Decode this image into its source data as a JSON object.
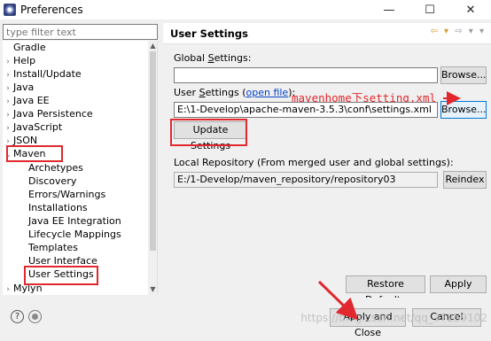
{
  "window": {
    "title": "Preferences",
    "minimize": "—",
    "maximize": "☐",
    "close": "✕"
  },
  "filter": {
    "placeholder": "type filter text"
  },
  "tree": {
    "items": [
      {
        "label": "Gradle",
        "twisty": ""
      },
      {
        "label": "Help",
        "twisty": "›"
      },
      {
        "label": "Install/Update",
        "twisty": "›"
      },
      {
        "label": "Java",
        "twisty": "›"
      },
      {
        "label": "Java EE",
        "twisty": "›"
      },
      {
        "label": "Java Persistence",
        "twisty": "›"
      },
      {
        "label": "JavaScript",
        "twisty": "›"
      },
      {
        "label": "JSON",
        "twisty": "›"
      },
      {
        "label": "Maven",
        "twisty": "⌄"
      },
      {
        "label": "Archetypes",
        "twisty": ""
      },
      {
        "label": "Discovery",
        "twisty": ""
      },
      {
        "label": "Errors/Warnings",
        "twisty": ""
      },
      {
        "label": "Installations",
        "twisty": ""
      },
      {
        "label": "Java EE Integration",
        "twisty": ""
      },
      {
        "label": "Lifecycle Mappings",
        "twisty": ""
      },
      {
        "label": "Templates",
        "twisty": ""
      },
      {
        "label": "User Interface",
        "twisty": ""
      },
      {
        "label": "User Settings",
        "twisty": ""
      },
      {
        "label": "Mylyn",
        "twisty": "›"
      }
    ]
  },
  "page": {
    "title": "User Settings",
    "global_settings_label_pre": "Global ",
    "global_settings_label_u": "S",
    "global_settings_label_post": "ettings:",
    "global_settings_value": "",
    "browse_global": "Browse...",
    "user_settings_label_pre": "User ",
    "user_settings_label_u": "S",
    "user_settings_label_post": "ettings (",
    "open_file_link": "open file",
    "user_settings_label_end": "):",
    "annotation": "mavenhome下setting.xml",
    "user_settings_value": "E:\\1-Develop\\apache-maven-3.5.3\\conf\\settings.xml",
    "browse_user": "Browse...",
    "update_settings": "Update Settings",
    "local_repo_label": "Local Repository (From merged user and global settings):",
    "local_repo_value": "E:/1-Develop/maven_repository/repository03",
    "reindex": "Reindex",
    "restore_defaults": "Restore Defaults",
    "apply": "Apply"
  },
  "footer": {
    "help": "?",
    "apply_and_close": "Apply and Close",
    "cancel": "Cancel",
    "watermark": "https://blog.csdn.net/qq_37259102"
  },
  "colors": {
    "accent_red": "#e0282e",
    "link": "#0645c5",
    "focus": "#0078d7"
  }
}
